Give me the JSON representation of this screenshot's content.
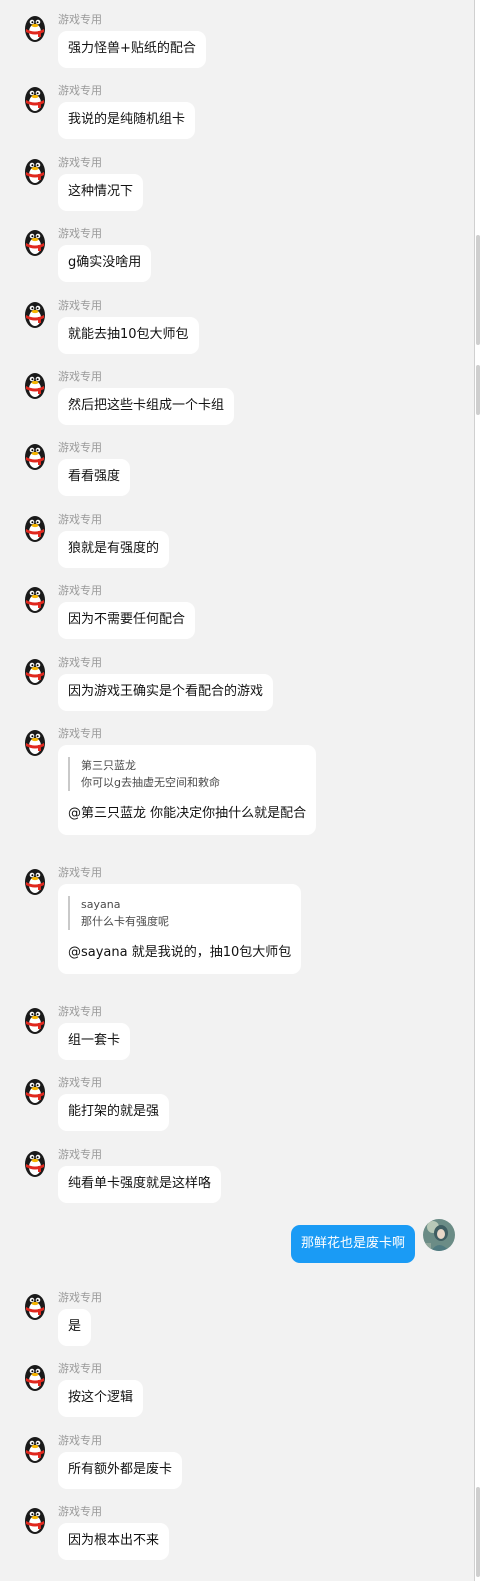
{
  "messages": [
    {
      "sender": "游戏专用",
      "text": "强力怪兽+贴纸的配合"
    },
    {
      "sender": "游戏专用",
      "text": "我说的是纯随机组卡"
    },
    {
      "sender": "游戏专用",
      "text": "这种情况下"
    },
    {
      "sender": "游戏专用",
      "text": "g确实没啥用"
    },
    {
      "sender": "游戏专用",
      "text": "就能去抽10包大师包"
    },
    {
      "sender": "游戏专用",
      "text": "然后把这些卡组成一个卡组"
    },
    {
      "sender": "游戏专用",
      "text": "看看强度"
    },
    {
      "sender": "游戏专用",
      "text": "狼就是有强度的"
    },
    {
      "sender": "游戏专用",
      "text": "因为不需要任何配合"
    },
    {
      "sender": "游戏专用",
      "text": "因为游戏王确实是个看配合的游戏"
    },
    {
      "sender": "游戏专用",
      "quote_name": "第三只蓝龙",
      "quote_text": "你可以g去抽虚无空间和敕命",
      "text": "@第三只蓝龙 你能决定你抽什么就是配合"
    },
    {
      "sender": "游戏专用",
      "quote_name": "sayana",
      "quote_text": "那什么卡有强度呢",
      "text": "@sayana 就是我说的，抽10包大师包"
    },
    {
      "sender": "游戏专用",
      "text": "组一套卡"
    },
    {
      "sender": "游戏专用",
      "text": "能打架的就是强"
    },
    {
      "sender": "游戏专用",
      "text": "纯看单卡强度就是这样咯"
    },
    {
      "self": true,
      "text": "那鲜花也是废卡啊"
    },
    {
      "sender": "游戏专用",
      "text": "是"
    },
    {
      "sender": "游戏专用",
      "text": "按这个逻辑"
    },
    {
      "sender": "游戏专用",
      "text": "所有额外都是废卡"
    },
    {
      "sender": "游戏专用",
      "text": "因为根本出不来"
    }
  ],
  "icons": {
    "other_avatar": "qq-penguin-avatar-icon",
    "self_avatar": "user-avatar-icon"
  },
  "colors": {
    "background": "#f2f2f2",
    "bubble_other": "#ffffff",
    "bubble_self": "#1a9bf5",
    "sender_name": "#9a9a9a"
  }
}
